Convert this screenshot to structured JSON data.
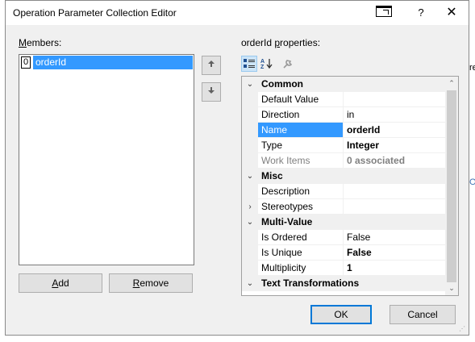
{
  "background": {
    "frag_top": "re",
    "frag_mid": "Or"
  },
  "window": {
    "title": "Operation Parameter Collection Editor",
    "help_label": "?",
    "close_label": "✕"
  },
  "members": {
    "label_prefix": "",
    "label_accel": "M",
    "label_rest": "embers:",
    "items": [
      {
        "index": "0",
        "name": "orderId"
      }
    ],
    "up_glyph": "🠉",
    "down_glyph": "🠋"
  },
  "buttons": {
    "add_accel": "A",
    "add_rest": "dd",
    "remove_accel": "R",
    "remove_rest": "emove",
    "ok": "OK",
    "cancel": "Cancel"
  },
  "properties": {
    "label_prefix": "orderId ",
    "label_accel": "p",
    "label_rest": "roperties:",
    "toolbar": {
      "categorized_icon": "categorized-icon",
      "alphabetical_icon": "alphabetical-icon",
      "pages_icon": "property-pages-icon"
    },
    "rows": [
      {
        "kind": "category",
        "name": "Common",
        "expander": "⌄"
      },
      {
        "kind": "prop",
        "name": "Default Value",
        "value": ""
      },
      {
        "kind": "prop",
        "name": "Direction",
        "value": "in"
      },
      {
        "kind": "prop",
        "name": "Name",
        "value": "orderId",
        "selected": true,
        "bold": true
      },
      {
        "kind": "prop",
        "name": "Type",
        "value": "Integer",
        "bold": true
      },
      {
        "kind": "prop",
        "name": "Work Items",
        "value": "0 associated",
        "gray": true
      },
      {
        "kind": "category",
        "name": "Misc",
        "expander": "⌄"
      },
      {
        "kind": "prop",
        "name": "Description",
        "value": ""
      },
      {
        "kind": "prop",
        "name": "Stereotypes",
        "value": "",
        "expander": "›"
      },
      {
        "kind": "category",
        "name": "Multi-Value",
        "expander": "⌄"
      },
      {
        "kind": "prop",
        "name": "Is Ordered",
        "value": "False"
      },
      {
        "kind": "prop",
        "name": "Is Unique",
        "value": "False",
        "bold": true
      },
      {
        "kind": "prop",
        "name": "Multiplicity",
        "value": "1",
        "bold": true
      },
      {
        "kind": "category",
        "name": "Text Transformations",
        "expander": "⌄"
      }
    ]
  }
}
